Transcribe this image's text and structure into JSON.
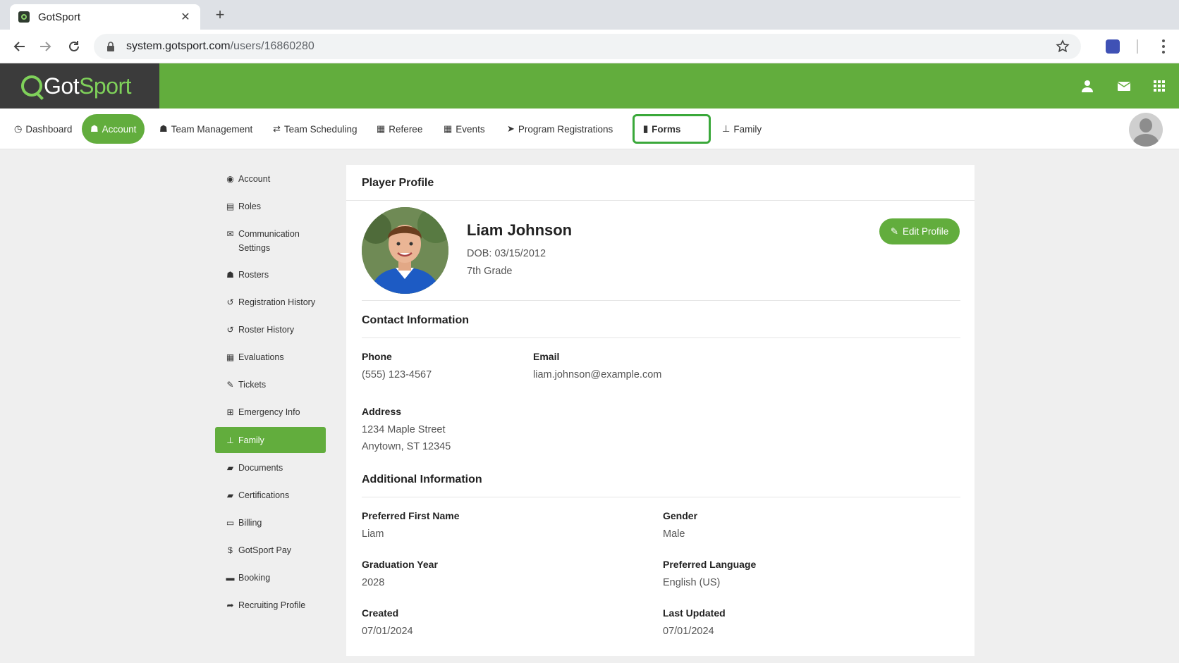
{
  "browser": {
    "tab_title": "GotSport",
    "url_host": "system.gotsport.com",
    "url_path": "/users/16860280"
  },
  "app": {
    "logo_pre": "Got",
    "logo_post": "Sport",
    "brand_color": "#62ad3d"
  },
  "nav": {
    "items": [
      {
        "label": "Dashboard",
        "icon": "dashboard-icon"
      },
      {
        "label": "Account",
        "icon": "users-icon"
      },
      {
        "label": "Team Management",
        "icon": "users-icon"
      },
      {
        "label": "Team Scheduling",
        "icon": "exchange-icon"
      },
      {
        "label": "Referee",
        "icon": "calendar-icon"
      },
      {
        "label": "Events",
        "icon": "calendar-icon"
      },
      {
        "label": "Program Registrations",
        "icon": "paper-plane-icon"
      },
      {
        "label": "Forms",
        "icon": "file-icon"
      },
      {
        "label": "Family",
        "icon": "sitemap-icon"
      }
    ]
  },
  "sidebar": {
    "items": [
      {
        "label": "Account",
        "icon": "user-circle-icon"
      },
      {
        "label": "Roles",
        "icon": "id-card-icon"
      },
      {
        "label": "Communication Settings",
        "icon": "envelope-icon"
      },
      {
        "label": "Rosters",
        "icon": "users-icon"
      },
      {
        "label": "Registration History",
        "icon": "history-icon"
      },
      {
        "label": "Roster History",
        "icon": "history-icon"
      },
      {
        "label": "Evaluations",
        "icon": "calendar-check-icon"
      },
      {
        "label": "Tickets",
        "icon": "thumbtack-icon"
      },
      {
        "label": "Emergency Info",
        "icon": "plus-square-icon"
      },
      {
        "label": "Family",
        "icon": "sitemap-icon"
      },
      {
        "label": "Documents",
        "icon": "folder-open-icon"
      },
      {
        "label": "Certifications",
        "icon": "folder-open-icon"
      },
      {
        "label": "Billing",
        "icon": "credit-card-icon"
      },
      {
        "label": "GotSport Pay",
        "icon": "dollar-icon"
      },
      {
        "label": "Booking",
        "icon": "bed-icon"
      },
      {
        "label": "Recruiting Profile",
        "icon": "share-icon"
      }
    ]
  },
  "profile": {
    "card_title": "Player Profile",
    "name": "Liam Johnson",
    "dob": "DOB: 03/15/2012",
    "grade": "7th Grade",
    "edit_label": "Edit Profile",
    "contact_title": "Contact Information",
    "phone_label": "Phone",
    "phone": "(555) 123-4567",
    "email_label": "Email",
    "email": "liam.johnson@example.com",
    "address_label": "Address",
    "address_line1": "1234 Maple Street",
    "address_line2": "Anytown, ST 12345",
    "additional_title": "Additional Information",
    "pref_name_label": "Preferred First Name",
    "pref_name": "Liam",
    "gender_label": "Gender",
    "gender": "Male",
    "grad_year_label": "Graduation Year",
    "grad_year": "2028",
    "pref_lang_label": "Preferred Language",
    "pref_lang": "English (US)",
    "created_label": "Created",
    "created": "07/01/2024",
    "updated_label": "Last Updated",
    "updated": "07/01/2024"
  }
}
